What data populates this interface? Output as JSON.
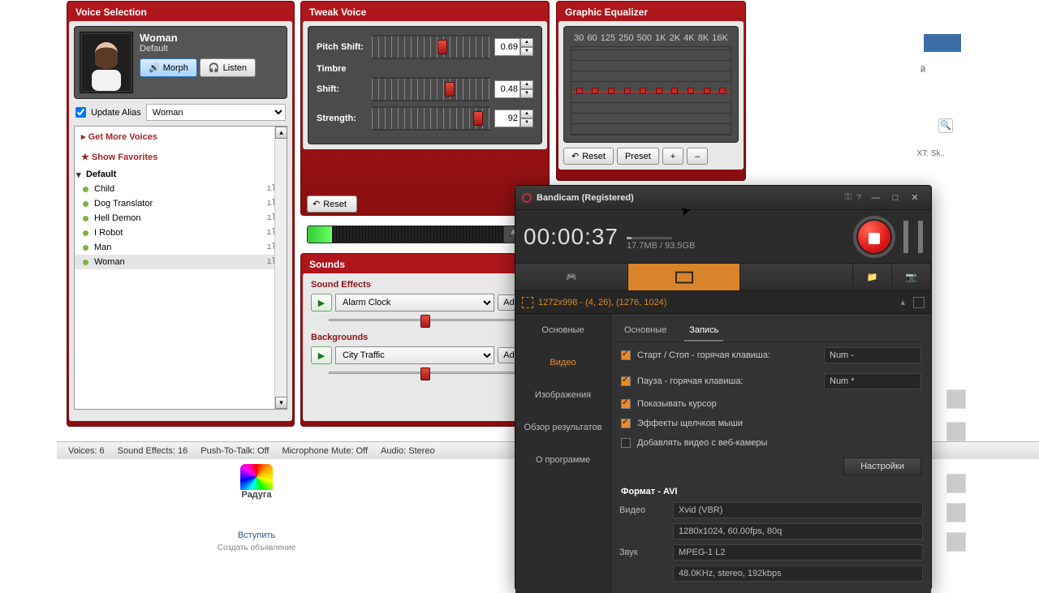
{
  "voice": {
    "panel_title": "Voice Selection",
    "name": "Woman",
    "subtitle": "Default",
    "morph": "Morph",
    "listen": "Listen",
    "update_alias": "Update Alias",
    "alias_value": "Woman",
    "list": {
      "get_more": "Get More Voices",
      "show_fav": "Show Favorites",
      "group": "Default",
      "items": [
        "Child",
        "Dog Translator",
        "Hell Demon",
        "I Robot",
        "Man",
        "Woman"
      ]
    }
  },
  "tweak": {
    "panel_title": "Tweak Voice",
    "pitch_label": "Pitch Shift:",
    "pitch_value": "0.69",
    "timbre_label": "Timbre",
    "shift_label": "Shift:",
    "shift_value": "0.48",
    "strength_label": "Strength:",
    "strength_value": "92",
    "reset": "Reset"
  },
  "sounds": {
    "panel_title": "Sounds",
    "effects_title": "Sound Effects",
    "effects_value": "Alarm Clock",
    "bg_title": "Backgrounds",
    "bg_value": "City Traffic",
    "advanced": "Advanc"
  },
  "eq": {
    "panel_title": "Graphic Equalizer",
    "freqs": [
      "30",
      "60",
      "125",
      "250",
      "500",
      "1K",
      "2K",
      "4K",
      "8K",
      "16K"
    ],
    "reset": "Reset",
    "preset": "Preset",
    "plus": "+",
    "minus": "–"
  },
  "status": {
    "voices": "Voices: 6",
    "sfx": "Sound Effects: 16",
    "ptt": "Push-To-Talk: Off",
    "mic": "Microphone Mute: Off",
    "audio": "Audio: Stereo"
  },
  "vk": {
    "brand": "Радуга",
    "join": "Вступить",
    "create": "Создать объявление",
    "txt": "XT: Sk.."
  },
  "bandicam": {
    "title": "Bandicam (Registered)",
    "time": "00:00:37",
    "size": "17.7MB / 93.5GB",
    "region": "1272x998 - (4, 26), (1276, 1024)",
    "side": [
      "Основные",
      "Видео",
      "Изображения",
      "Обзор результатов",
      "О программе"
    ],
    "tab_main": "Основные",
    "tab_rec": "Запись",
    "chk_start": "Старт / Стоп - горячая клавиша:",
    "val_start": "Num -",
    "chk_pause": "Пауза - горячая клавиша:",
    "val_pause": "Num *",
    "chk_cursor": "Показывать курсор",
    "chk_clicks": "Эффекты щелчков мыши",
    "chk_webcam": "Добавлять видео с веб-камеры",
    "settings": "Настройки",
    "format": "Формат - AVI",
    "video": "Видео",
    "video_v1": "Xvid (VBR)",
    "video_v2": "1280x1024, 60.00fps, 80q",
    "sound": "Звук",
    "sound_v1": "MPEG-1 L2",
    "sound_v2": "48.0KHz, stereo, 192kbps"
  }
}
